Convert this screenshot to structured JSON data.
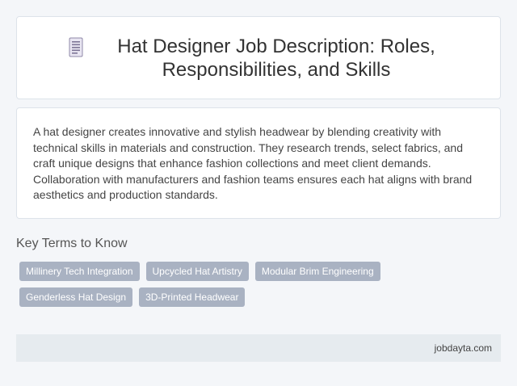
{
  "header": {
    "icon": "document-icon",
    "title": "Hat Designer Job Description: Roles, Responsibilities, and Skills"
  },
  "description": {
    "text": "A hat designer creates innovative and stylish headwear by blending creativity with technical skills in materials and construction. They research trends, select fabrics, and craft unique designs that enhance fashion collections and meet client demands. Collaboration with manufacturers and fashion teams ensures each hat aligns with brand aesthetics and production standards."
  },
  "key_terms": {
    "title": "Key Terms to Know",
    "tags": [
      "Millinery Tech Integration",
      "Upcycled Hat Artistry",
      "Modular Brim Engineering",
      "Genderless Hat Design",
      "3D-Printed Headwear"
    ]
  },
  "footer": {
    "site": "jobdayta.com"
  },
  "colors": {
    "background": "#f4f6f9",
    "card": "#ffffff",
    "tag": "#a9b2c2",
    "footer": "#e6ebef"
  }
}
